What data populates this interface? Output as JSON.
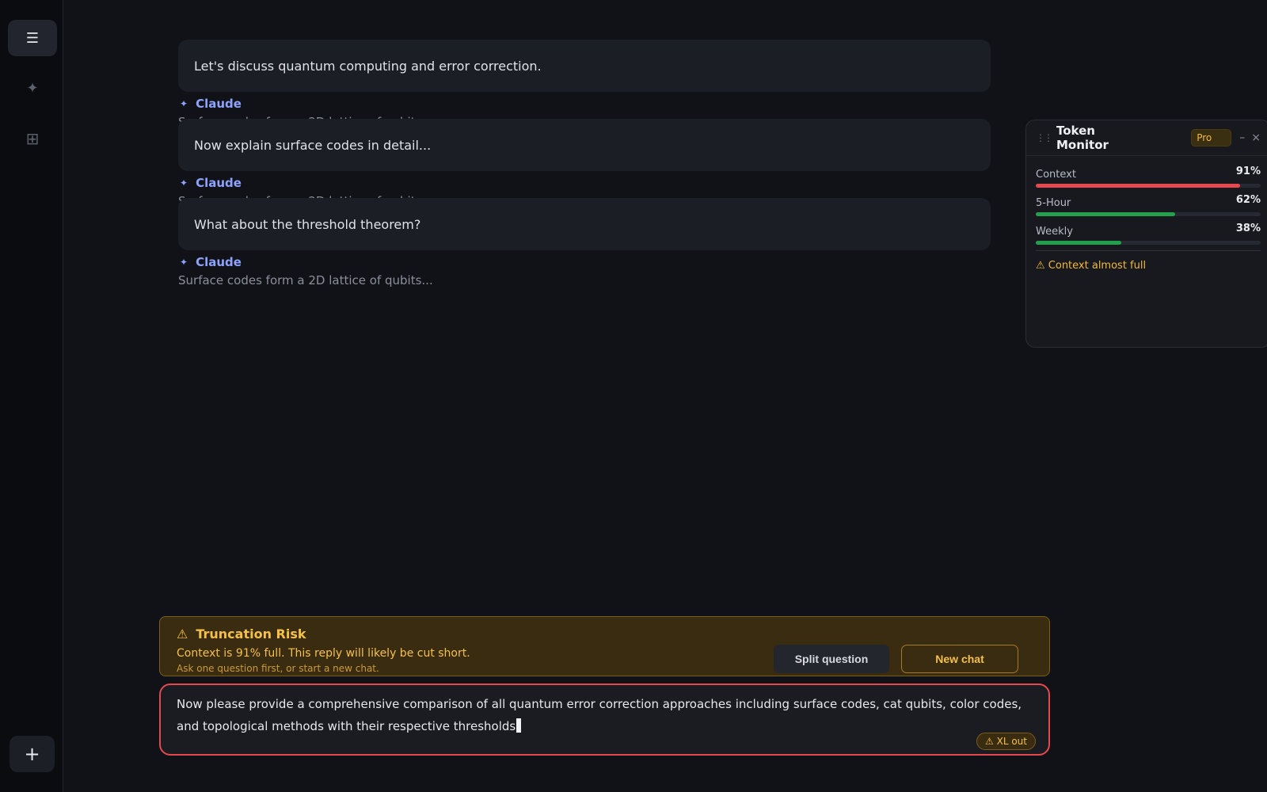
{
  "sidebar": {
    "menu_icon": "☰",
    "spark_icon": "✦",
    "grid_icon": "⊞",
    "new_icon": "+"
  },
  "conversation": {
    "messages": [
      {
        "user": "Let's discuss quantum computing and error correction.",
        "assistant_name": "Claude",
        "assistant_text": "Surface codes form a 2D lattice of qubits..."
      },
      {
        "user": "Now explain surface codes in detail...",
        "assistant_name": "Claude",
        "assistant_text": "Surface codes form a 2D lattice of qubits..."
      },
      {
        "user": "What about the threshold theorem?",
        "assistant_name": "Claude",
        "assistant_text": "Surface codes form a 2D lattice of qubits..."
      }
    ]
  },
  "token_monitor": {
    "title": "Token Monitor",
    "badge": "Pro",
    "minimize": "–",
    "close": "×",
    "metrics": [
      {
        "label": "Context",
        "value": "91%",
        "fraction": 0.91,
        "color": "#e5484d"
      },
      {
        "label": "5-Hour",
        "value": "62%",
        "fraction": 0.62,
        "color": "#22a04b"
      },
      {
        "label": "Weekly",
        "value": "38%",
        "fraction": 0.38,
        "color": "#22a04b"
      }
    ],
    "warning": "⚠ Context almost full"
  },
  "truncation": {
    "icon": "⚠",
    "title": "Truncation Risk",
    "message": "Context is 91% full. This reply will likely be cut short.",
    "sub": "Ask one question first, or start a new chat.",
    "split_label": "Split question",
    "new_label": "New chat"
  },
  "composer": {
    "text": "Now please provide a comprehensive comparison of all quantum error correction approaches including surface codes, cat qubits, color codes, and topological methods with their respective thresholds",
    "badge": "⚠ XL out"
  }
}
